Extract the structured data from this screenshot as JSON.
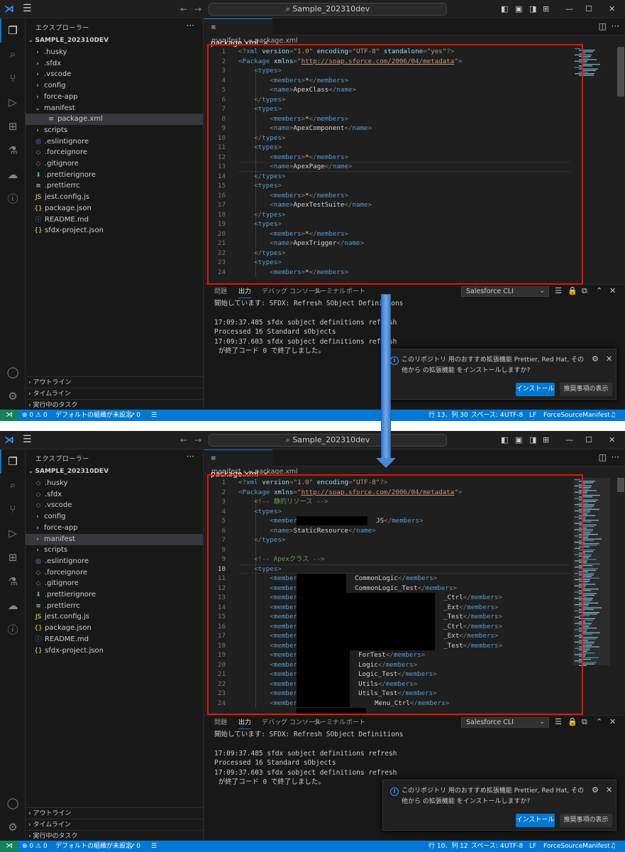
{
  "app": {
    "search_text": "Sample_202310dev",
    "explorer_title": "エクスプローラー",
    "workspace_root": "SAMPLE_202310DEV",
    "tab_label": "package.xml",
    "breadcrumb_folder": "manifest",
    "breadcrumb_file": "package.xml",
    "outline": "アウトライン",
    "timeline": "タイムライン",
    "running_tasks": "実行中のタスク"
  },
  "colors": {
    "accent": "#0078d4",
    "highlight_box": "#e51400",
    "status_bar": "#0078d4"
  },
  "files": [
    {
      "name": ".husky",
      "kind": "folder",
      "icon": "chevron-right-icon"
    },
    {
      "name": ".sfdx",
      "kind": "folder",
      "icon": "chevron-right-icon"
    },
    {
      "name": ".vscode",
      "kind": "folder",
      "icon": "chevron-right-icon"
    },
    {
      "name": "config",
      "kind": "folder",
      "icon": "chevron-right-icon"
    },
    {
      "name": "force-app",
      "kind": "folder",
      "icon": "chevron-right-icon"
    },
    {
      "name": "manifest",
      "kind": "folder",
      "icon": "chevron-down-icon"
    },
    {
      "name": "package.xml",
      "kind": "file",
      "icon": "lines-file-icon"
    },
    {
      "name": "scripts",
      "kind": "folder",
      "icon": "chevron-right-icon"
    },
    {
      "name": ".eslintignore",
      "kind": "file",
      "icon": "eslint-file-icon"
    },
    {
      "name": ".forceignore",
      "kind": "file",
      "icon": "diamond-file-icon"
    },
    {
      "name": ".gitignore",
      "kind": "file",
      "icon": "diamond-file-icon"
    },
    {
      "name": ".prettierignore",
      "kind": "file",
      "icon": "prettier-file-icon"
    },
    {
      "name": ".prettierrc",
      "kind": "file",
      "icon": "lines-file-icon"
    },
    {
      "name": "jest.config.js",
      "kind": "file",
      "icon": "js-file-icon"
    },
    {
      "name": "package.json",
      "kind": "file",
      "icon": "json-file-icon"
    },
    {
      "name": "README.md",
      "kind": "file",
      "icon": "info-file-icon"
    },
    {
      "name": "sfdx-project.json",
      "kind": "file",
      "icon": "json-file-icon"
    }
  ],
  "files_after": [
    {
      "name": ".husky"
    },
    {
      "name": ".sfdx"
    },
    {
      "name": ".vscode"
    },
    {
      "name": "config"
    },
    {
      "name": "force-app"
    },
    {
      "name": "manifest"
    },
    {
      "name": "scripts"
    },
    {
      "name": ".eslintignore"
    },
    {
      "name": ".forceignore"
    },
    {
      "name": ".gitignore"
    },
    {
      "name": ".prettierignore"
    },
    {
      "name": ".prettierrc"
    },
    {
      "name": "jest.config.js"
    },
    {
      "name": "package.json"
    },
    {
      "name": "README.md"
    },
    {
      "name": "sfdx-project.json"
    }
  ],
  "code_before": [
    "1",
    "2",
    "3",
    "4",
    "5",
    "6",
    "7",
    "8",
    "9",
    "10",
    "11",
    "12",
    "13",
    "14",
    "15",
    "16",
    "17",
    "18",
    "19",
    "20",
    "21",
    "22",
    "23",
    "24"
  ],
  "code_before_text": {
    "decl": "<?xml version=\"1.0\" encoding=\"UTF-8\" standalone=\"yes\"?>",
    "xmlns": "http://soap.sforce.com/2006/04/metadata",
    "types": [
      "ApexClass",
      "ApexComponent",
      "ApexPage",
      "ApexTestSuite",
      "ApexTrigger"
    ],
    "star": "*"
  },
  "code_after_text": {
    "decl": "<?xml version=\"1.0\" encoding=\"UTF-8\"?>",
    "comment_static": "<!-- 静的リソース -->",
    "static_member_tail": "JS",
    "static_resource": "StaticResource",
    "comment_apex": "<!-- Apexクラス -->",
    "members": [
      "CommonLogic",
      "CommonLogic_Test",
      "_Ctrl",
      "_Ext",
      "_Test",
      "_Ctrl",
      "_Ext",
      "_Test",
      "ForTest",
      "Logic",
      "Logic_Test",
      "Utils",
      "Utils_Test",
      "Menu_Ctrl"
    ]
  },
  "panel": {
    "tabs": [
      "問題",
      "出力",
      "デバッグ コンソール",
      "ターミナル",
      "ポート"
    ],
    "active_tab": "出力",
    "channel": "Salesforce CLI",
    "lines": [
      "開始しています: SFDX: Refresh SObject Definitions",
      "",
      "17:09:37.485 sfdx sobject definitions refresh",
      "Processed 16 Standard sObjects",
      "17:09:37.603 sfdx sobject definitions refresh",
      " が終了コード 0 で終了しました。"
    ]
  },
  "toast": {
    "message": "このリポジトリ 用のおすすめ拡張機能 Prettier, Red Hat, その他から の拡張機能 をインストールしますか?",
    "install": "インストール",
    "show_recommendations": "推奨事項の表示"
  },
  "status_before": {
    "errors": "0",
    "warnings": "0",
    "org": "デフォルトの組織が未設定",
    "ports": "0",
    "position": "行 13、列 30",
    "spaces": "スペース: 4",
    "encoding": "UTF-8",
    "eol": "LF",
    "task": "ForceSourceManifest"
  },
  "status_after": {
    "errors": "0",
    "warnings": "0",
    "org": "デフォルトの組織が未設定",
    "ports": "0",
    "position": "行 10、列 12",
    "spaces": "スペース: 4",
    "encoding": "UTF-8",
    "eol": "LF",
    "task": "ForceSourceManifest"
  }
}
